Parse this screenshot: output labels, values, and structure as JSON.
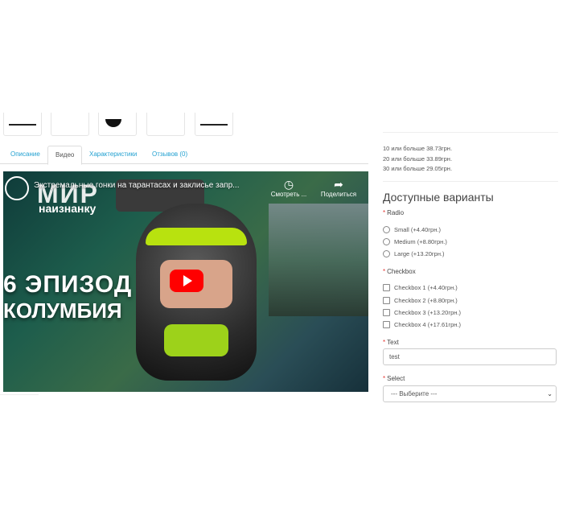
{
  "tabs": [
    {
      "label": "Описание"
    },
    {
      "label": "Видео"
    },
    {
      "label": "Характеристики"
    },
    {
      "label": "Отзывов (0)"
    }
  ],
  "video": {
    "title": "Экстремальные гонки на тарантасах и заклисье запр...",
    "channel_logo_text": "МИР",
    "channel_logo_sub": "наизнанку",
    "overlay_episode": "6 ЭПИЗОД",
    "overlay_country": "КОЛУМБИЯ",
    "watch_later_label": "Смотреть ...",
    "share_label": "Поделиться"
  },
  "discounts": [
    "10 или больше 38.73грн.",
    "20 или больше 33.89грн.",
    "30 или больше 29.05грн."
  ],
  "options_title": "Доступные варианты",
  "radio": {
    "label": "Radio",
    "items": [
      "Small (+4.40грн.)",
      "Medium (+8.80грн.)",
      "Large (+13.20грн.)"
    ]
  },
  "checkbox": {
    "label": "Checkbox",
    "items": [
      "Checkbox 1 (+4.40грн.)",
      "Checkbox 2 (+8.80грн.)",
      "Checkbox 3 (+13.20грн.)",
      "Checkbox 4 (+17.61грн.)"
    ]
  },
  "text_field": {
    "label": "Text",
    "value": "test"
  },
  "select_field": {
    "label": "Select",
    "value": "--- Выберите ---"
  },
  "colors": {
    "link": "#23a1d1",
    "required": "#e53935",
    "youtube_red": "#ff0000"
  }
}
